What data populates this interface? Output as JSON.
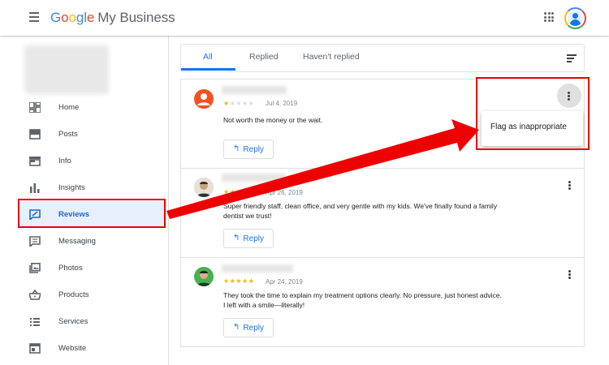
{
  "app": {
    "brand_g": "G",
    "brand_o1": "o",
    "brand_o2": "o",
    "brand_g2": "g",
    "brand_l": "l",
    "brand_e": "e",
    "brand_rest": "My Business"
  },
  "sidebar": {
    "items": [
      {
        "label": "Home",
        "icon": "dashboard-icon"
      },
      {
        "label": "Posts",
        "icon": "posts-icon"
      },
      {
        "label": "Info",
        "icon": "storefront-icon"
      },
      {
        "label": "Insights",
        "icon": "bar-chart-icon"
      },
      {
        "label": "Reviews",
        "icon": "reviews-icon",
        "active": true
      },
      {
        "label": "Messaging",
        "icon": "message-icon"
      },
      {
        "label": "Photos",
        "icon": "photos-icon"
      },
      {
        "label": "Products",
        "icon": "basket-icon"
      },
      {
        "label": "Services",
        "icon": "list-icon"
      },
      {
        "label": "Website",
        "icon": "website-icon"
      }
    ]
  },
  "tabs": [
    {
      "label": "All",
      "active": true
    },
    {
      "label": "Replied"
    },
    {
      "label": "Haven't replied"
    }
  ],
  "reviews": [
    {
      "rating": 1,
      "date": "Jul 4, 2019",
      "text_line1": "Not worth the money or the wait.",
      "text_line2": "",
      "reply_label": "Reply"
    },
    {
      "rating": 5,
      "date": "Apr 26, 2019",
      "text_line1": "Super friendly staff, clean office, and very gentle with my kids. We've finally found a family",
      "text_line2": "dentist we trust!",
      "reply_label": "Reply"
    },
    {
      "rating": 5,
      "date": "Apr 24, 2019",
      "text_line1": "They took the time to explain my treatment options clearly. No pressure, just honest advice.",
      "text_line2": "I left with a smile—literally!",
      "reply_label": "Reply"
    }
  ],
  "menu": {
    "flag_label": "Flag as inappropriate"
  },
  "colors": {
    "accent": "#1a73e8",
    "annotation": "#ee0000",
    "star": "#f4b400"
  }
}
